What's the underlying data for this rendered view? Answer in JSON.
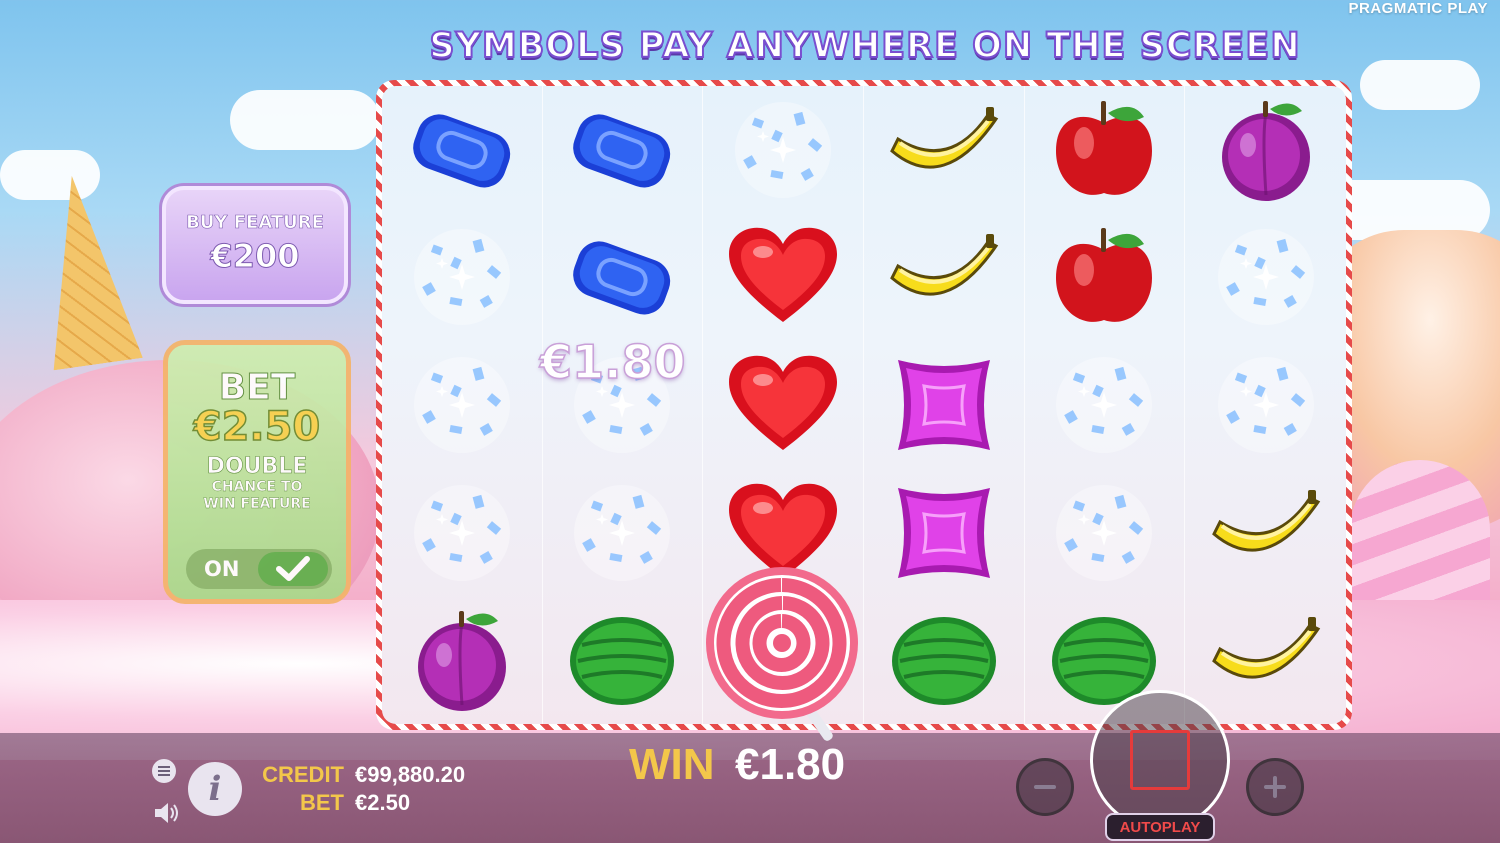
{
  "provider_logo": "PRAGMATIC PLAY",
  "banner_text": "SYMBOLS PAY ANYWHERE ON THE SCREEN",
  "buy_feature": {
    "title": "BUY FEATURE",
    "price": "€200"
  },
  "ante_bet": {
    "bet_label": "BET",
    "bet_amount": "€2.50",
    "double_label": "DOUBLE",
    "chance_line1": "CHANCE TO",
    "chance_line2": "WIN FEATURE",
    "toggle_label": "ON",
    "toggle_state": true
  },
  "floating_win": "€1.80",
  "reels": [
    [
      "blue-candy",
      "exploding",
      "exploding",
      "exploding",
      "purple-plum"
    ],
    [
      "blue-candy",
      "blue-candy",
      "exploding",
      "exploding",
      "green-melon"
    ],
    [
      "exploding",
      "red-heart",
      "red-heart",
      "red-heart",
      "lollipop-scatter"
    ],
    [
      "yellow-banana",
      "yellow-banana",
      "purple-square",
      "purple-square",
      "green-melon"
    ],
    [
      "red-apple",
      "red-apple",
      "exploding",
      "exploding",
      "green-melon"
    ],
    [
      "purple-plum",
      "exploding",
      "exploding",
      "yellow-banana",
      "yellow-banana"
    ]
  ],
  "bottom_bar": {
    "credit_label": "CREDIT",
    "credit_value": "€99,880.20",
    "bet_label": "BET",
    "bet_value": "€2.50",
    "win_label": "WIN",
    "win_value": "€1.80",
    "autoplay_label": "AUTOPLAY"
  },
  "icons": {
    "menu": "menu-icon",
    "sound": "speaker-icon",
    "info": "info-icon",
    "minus": "minus-icon",
    "plus": "plus-icon",
    "stop": "stop-icon",
    "check": "check-icon"
  },
  "colors": {
    "accent_gold": "#f3c74a",
    "stop_red": "#e53b3b",
    "frame_red": "#e64a4a"
  }
}
